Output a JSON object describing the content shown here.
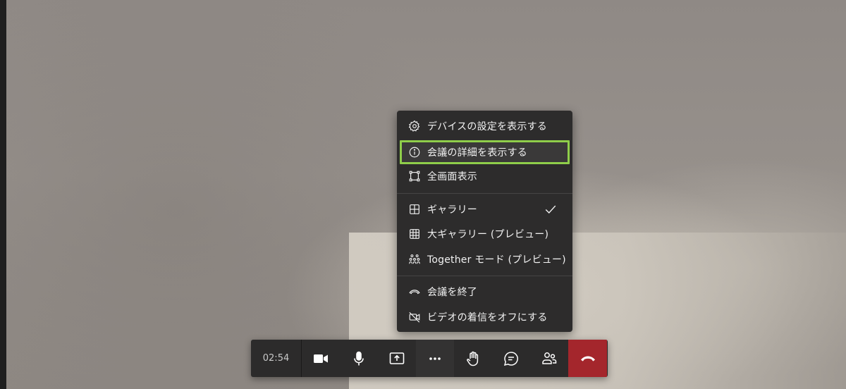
{
  "menu": {
    "items": [
      {
        "label": "デバイスの設定を表示する",
        "icon": "gear-icon"
      },
      {
        "label": "会議の詳細を表示する",
        "icon": "info-icon"
      },
      {
        "label": "全画面表示",
        "icon": "fullscreen-icon"
      },
      {
        "label": "ギャラリー",
        "icon": "gallery-icon",
        "checked": true
      },
      {
        "label": "大ギャラリー (プレビュー)",
        "icon": "large-gallery-icon"
      },
      {
        "label": "Together モード (プレビュー)",
        "icon": "together-mode-icon"
      },
      {
        "label": "会議を終了",
        "icon": "end-meeting-icon"
      },
      {
        "label": "ビデオの着信をオフにする",
        "icon": "video-off-icon"
      }
    ],
    "highlight_color": "#8fce4a"
  },
  "toolbar": {
    "timer": "02:54",
    "buttons": [
      {
        "name": "camera",
        "icon": "camera-icon"
      },
      {
        "name": "microphone",
        "icon": "microphone-icon"
      },
      {
        "name": "share",
        "icon": "share-screen-icon"
      },
      {
        "name": "more",
        "icon": "more-options-icon"
      },
      {
        "name": "raise-hand",
        "icon": "hand-icon"
      },
      {
        "name": "chat",
        "icon": "chat-icon"
      },
      {
        "name": "participants",
        "icon": "participants-icon"
      },
      {
        "name": "hang-up",
        "icon": "phone-hangup-icon",
        "color": "#a4262c"
      }
    ]
  }
}
